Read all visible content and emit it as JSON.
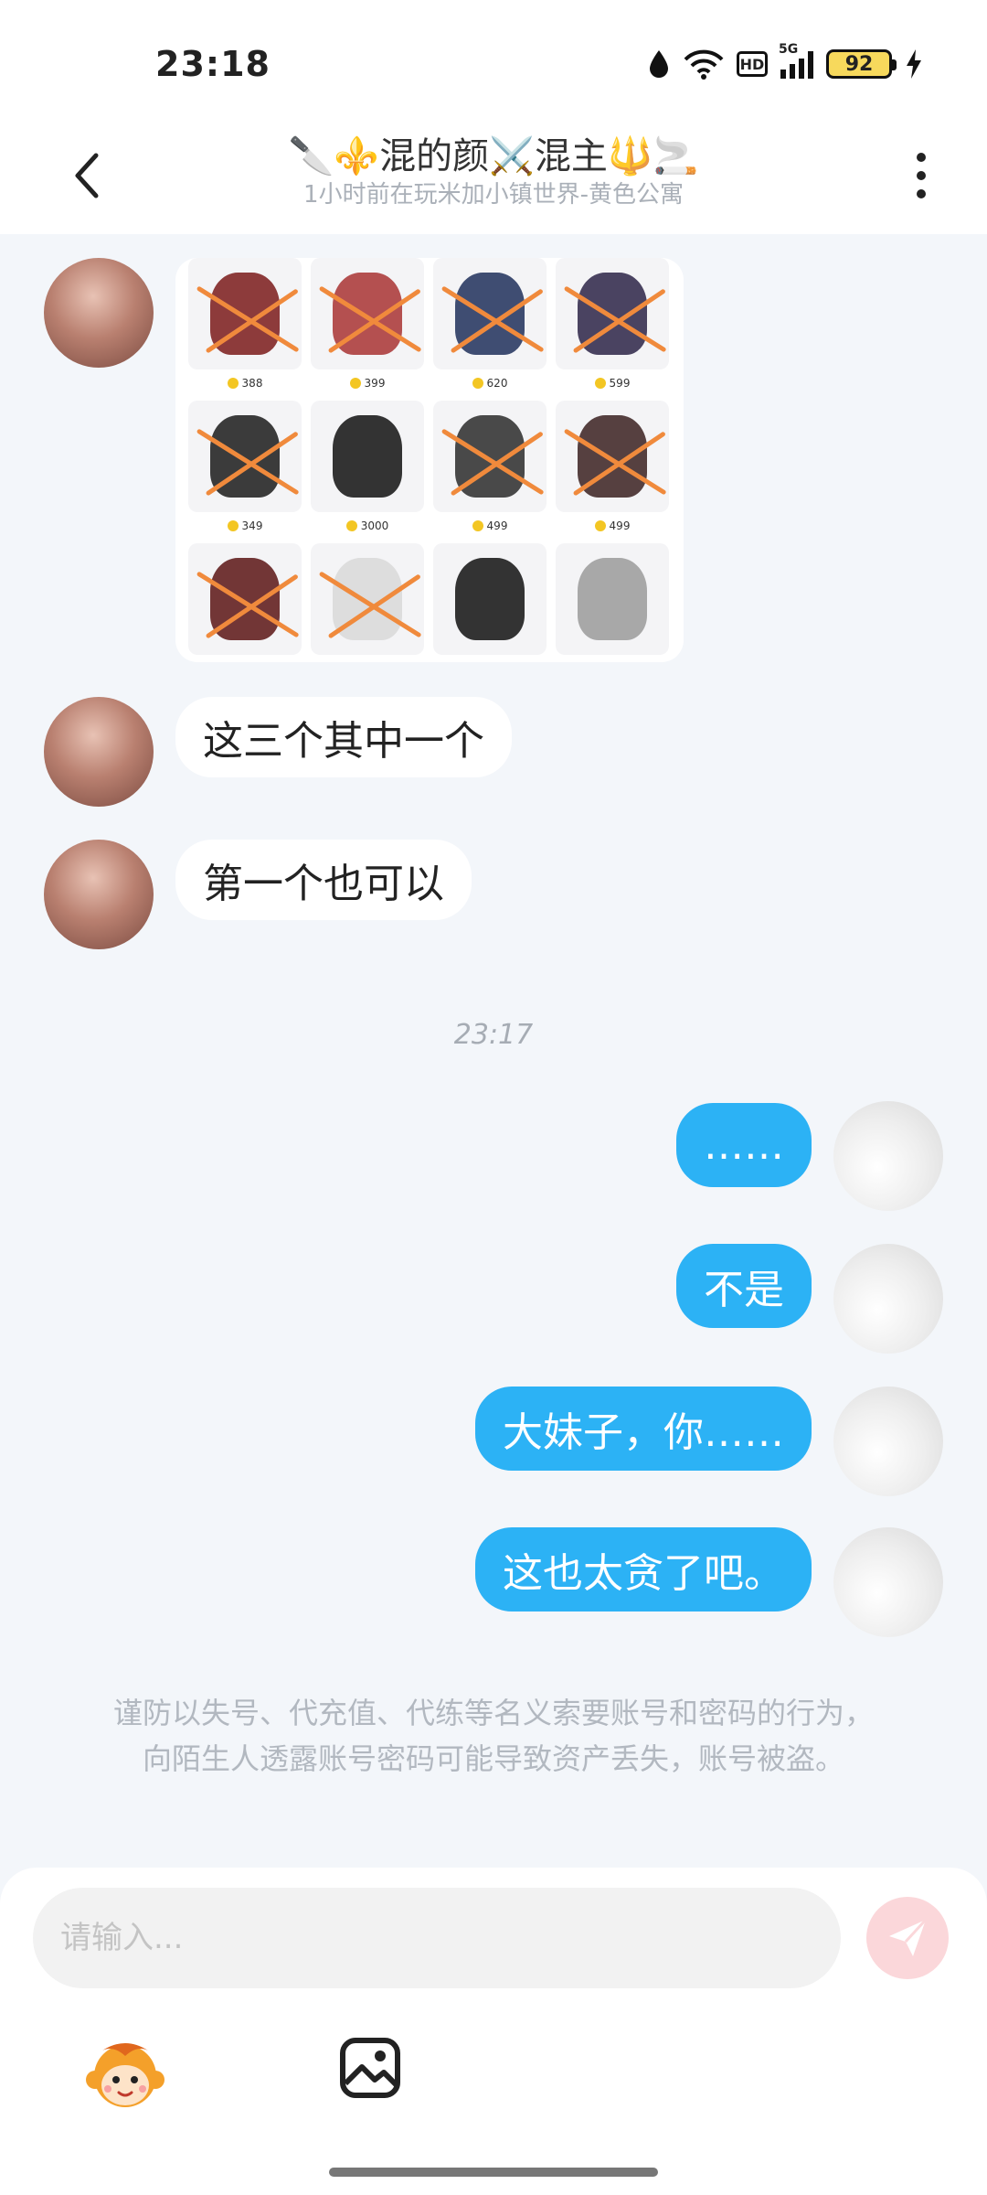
{
  "status_bar": {
    "time": "23:18",
    "battery": "92",
    "network_type": "5G",
    "hd_label": "HD"
  },
  "header": {
    "title": "🔪⚜️混的颜⚔️混主🔱🚬",
    "subtitle": "1小时前在玩米加小镇世界-黄色公寓"
  },
  "image_items": [
    {
      "price": "388",
      "crossed": true
    },
    {
      "price": "399",
      "crossed": true
    },
    {
      "price": "620",
      "crossed": true
    },
    {
      "price": "599",
      "crossed": true
    },
    {
      "price": "349",
      "crossed": true
    },
    {
      "price": "3000",
      "crossed": false
    },
    {
      "price": "499",
      "crossed": true
    },
    {
      "price": "499",
      "crossed": true
    },
    {
      "price": "",
      "crossed": true
    },
    {
      "price": "",
      "crossed": true
    },
    {
      "price": "",
      "crossed": false
    },
    {
      "price": "",
      "crossed": false
    }
  ],
  "messages": {
    "incoming_1": "这三个其中一个",
    "incoming_2": "第一个也可以",
    "timestamp": "23:17",
    "outgoing_1": "……",
    "outgoing_2": "不是",
    "outgoing_3": "大妹子，你……",
    "outgoing_4": "这也太贪了吧。"
  },
  "warning": "谨防以失号、代充值、代练等名义索要账号和密码的行为，向陌生人透露账号密码可能导致资产丢失，账号被盗。",
  "input": {
    "placeholder": "请输入..."
  },
  "colors": {
    "outgoing_bubble": "#2cb2f5",
    "send_button": "#fbd7da",
    "background": "#f3f6fa",
    "strike": "#f08a3c"
  }
}
